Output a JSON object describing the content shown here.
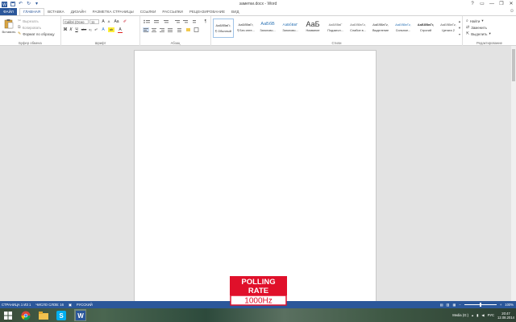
{
  "window": {
    "title": "заметки.docx - Word",
    "controls": [
      "?",
      "▭",
      "—",
      "❐",
      "✕"
    ]
  },
  "quick_access": [
    "save-icon",
    "undo-icon",
    "redo-icon",
    "customize-icon"
  ],
  "tabs": {
    "file": "ФАЙЛ",
    "items": [
      "ГЛАВНАЯ",
      "ВСТАВКА",
      "ДИЗАЙН",
      "РАЗМЕТКА СТРАНИЦЫ",
      "ССЫЛКИ",
      "РАССЫЛКИ",
      "РЕЦЕНЗИРОВАНИЕ",
      "ВИД"
    ],
    "active": "ГЛАВНАЯ"
  },
  "ribbon": {
    "clipboard": {
      "label": "Буфер обмена",
      "paste": "Вставить",
      "cut": "Вырезать",
      "copy": "Копировать",
      "format_painter": "Формат по образцу"
    },
    "font": {
      "label": "Шрифт",
      "font_name": "Calibri (Осно",
      "font_size": "11",
      "grow": "A",
      "shrink": "A",
      "case": "Aa",
      "clear": "✐",
      "bold": "Ж",
      "italic": "К",
      "underline": "Ч",
      "strike": "abc",
      "sub": "x₂",
      "sup": "x²",
      "effects": "A",
      "highlight": "ab",
      "color": "A"
    },
    "paragraph": {
      "label": "Абзац",
      "pilcrow": "¶"
    },
    "styles": {
      "label": "Стили",
      "items": [
        {
          "preview": "АаБбВвГг,",
          "name": "¶ Обычный"
        },
        {
          "preview": "АаБбВвГг,",
          "name": "¶ Без инте..."
        },
        {
          "preview": "АаБбВ",
          "name": "Заголово..."
        },
        {
          "preview": "АаБбВвГ",
          "name": "Заголово..."
        },
        {
          "preview": "АаБ",
          "name": "Название"
        },
        {
          "preview": "АаБбВвГ",
          "name": "Подзагол..."
        },
        {
          "preview": "АаБбВвГг,",
          "name": "Слабое в..."
        },
        {
          "preview": "АаБбВвГг,",
          "name": "Выделение"
        },
        {
          "preview": "АаБбВвГг,",
          "name": "Сильное..."
        },
        {
          "preview": "АаБбВвГг,",
          "name": "Строгий"
        },
        {
          "preview": "АаБбВвГг,",
          "name": "Цитата 2"
        }
      ]
    },
    "editing": {
      "label": "Редактирование",
      "find": "Найти",
      "replace": "Заменить",
      "select": "Выделить"
    }
  },
  "statusbar": {
    "page": "СТРАНИЦА 1 ИЗ 1",
    "words": "ЧИСЛО СЛОВ: 16",
    "language": "РУССКИЙ",
    "zoom": "100%"
  },
  "taskbar": {
    "apps": [
      "windows-start-icon",
      "chrome-icon",
      "file-explorer-icon",
      "skype-icon",
      "word-icon"
    ],
    "tray_label": "Media (G:)",
    "lang": "РУС",
    "time": "20:47",
    "date": "12.08.2014"
  },
  "logo": {
    "line1": "POLLING",
    "line2": "RATE",
    "line3": "1000Hz"
  },
  "colors": {
    "accent": "#2b579a",
    "logo_red": "#e0102a"
  }
}
